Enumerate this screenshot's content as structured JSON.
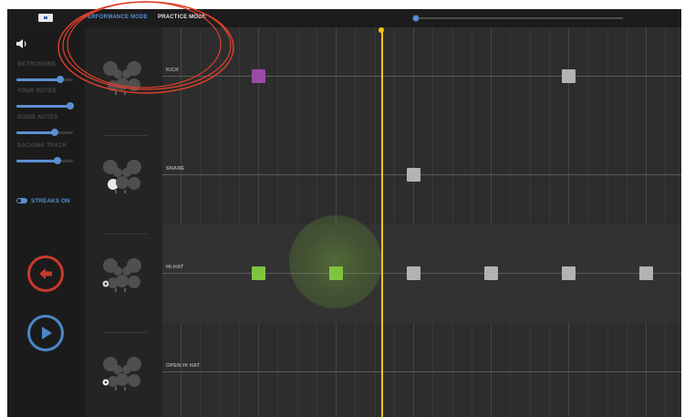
{
  "topbar": {
    "tabs": [
      {
        "label": "PERFORMANCE MODE",
        "active": true
      },
      {
        "label": "PRACTICE MODE",
        "active": false
      }
    ],
    "progress": 0.0
  },
  "controls": {
    "icons": {
      "volume": "speaker-icon"
    },
    "sliders": [
      {
        "label": "METRONOME",
        "value": 0.78
      },
      {
        "label": "YOUR NOTES",
        "value": 0.95
      },
      {
        "label": "GUIDE NOTES",
        "value": 0.68
      },
      {
        "label": "BACKING TRACK",
        "value": 0.72
      }
    ],
    "streaks": {
      "label": "STREAKS ON",
      "on": true
    }
  },
  "buttons": {
    "back": {
      "icon": "back-arrow-icon",
      "color": "#c7392c"
    },
    "play": {
      "icon": "play-icon",
      "color": "#4d86c7"
    }
  },
  "lanes": [
    {
      "label": "KICK",
      "highlight": "kick-drum"
    },
    {
      "label": "SNARE",
      "highlight": "snare-drum"
    },
    {
      "label": "HI-HAT",
      "highlight": "hi-hat"
    },
    {
      "label": "OPEN HI HAT",
      "highlight": "open-hi-hat"
    }
  ],
  "notes": [
    {
      "lane": 0,
      "beat": 1,
      "color": "#9b4aa8"
    },
    {
      "lane": 0,
      "beat": 5,
      "color": "#b3b3b3"
    },
    {
      "lane": 1,
      "beat": 3,
      "color": "#b3b3b3"
    },
    {
      "lane": 2,
      "beat": 1,
      "color": "#80c341"
    },
    {
      "lane": 2,
      "beat": 2,
      "color": "#80c341"
    },
    {
      "lane": 2,
      "beat": 3,
      "color": "#b3b3b3"
    },
    {
      "lane": 2,
      "beat": 4,
      "color": "#b3b3b3"
    },
    {
      "lane": 2,
      "beat": 5,
      "color": "#b3b3b3"
    },
    {
      "lane": 2,
      "beat": 6,
      "color": "#b3b3b3"
    }
  ],
  "colors": {
    "accent": "#5b8fd2",
    "playhead": "#f0c419",
    "annotation": "#e0402a"
  }
}
